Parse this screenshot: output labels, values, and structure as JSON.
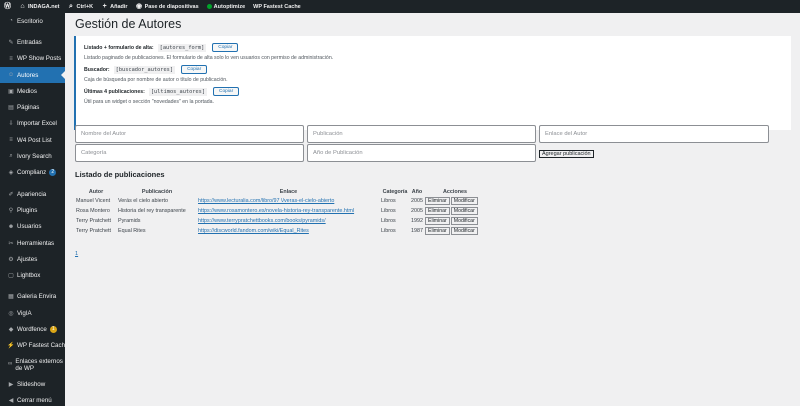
{
  "adminbar": {
    "site": "INDAGA.net",
    "ctrlk": "Ctrl+K",
    "add": "Añadir",
    "slides": "Pase de diapositivas",
    "autoptimize": "Autoptimize",
    "fastest_cache": "WP Fastest Cache"
  },
  "sidebar": {
    "items": [
      {
        "label": "Escritorio",
        "icon": "dashboard-icon"
      },
      {
        "label": "Entradas",
        "icon": "pin-icon"
      },
      {
        "label": "WP Show Posts",
        "icon": "list-icon"
      },
      {
        "label": "Autores",
        "icon": "users-icon"
      },
      {
        "label": "Medios",
        "icon": "media-icon"
      },
      {
        "label": "Páginas",
        "icon": "page-icon"
      },
      {
        "label": "Importar Excel",
        "icon": "import-icon"
      },
      {
        "label": "W4 Post List",
        "icon": "list-icon"
      },
      {
        "label": "Ivory Search",
        "icon": "search-icon"
      },
      {
        "label": "Complianz",
        "icon": "shield-icon",
        "badge": "2"
      },
      {
        "label": "Apariencia",
        "icon": "brush-icon"
      },
      {
        "label": "Plugins",
        "icon": "plugin-icon"
      },
      {
        "label": "Usuarios",
        "icon": "user-icon"
      },
      {
        "label": "Herramientas",
        "icon": "wrench-icon"
      },
      {
        "label": "Ajustes",
        "icon": "settings-icon"
      },
      {
        "label": "Lightbox",
        "icon": "lightbox-icon"
      },
      {
        "label": "Galeria Envira",
        "icon": "gallery-icon"
      },
      {
        "label": "VigIA",
        "icon": "eye-icon"
      },
      {
        "label": "Wordfence",
        "icon": "wordfence-icon",
        "badge": "1"
      },
      {
        "label": "WP Fastest Cache",
        "icon": "cache-icon"
      },
      {
        "label": "Enlaces externos de WP",
        "icon": "link-icon"
      },
      {
        "label": "Slideshow",
        "icon": "slideshow-icon"
      },
      {
        "label": "Cerrar menú",
        "icon": "collapse-icon"
      }
    ],
    "badge_colors": {
      "complianz": "#2271b1",
      "wordfence": "#dba617"
    }
  },
  "page": {
    "title": "Gestión de Autores"
  },
  "shortcodes": [
    {
      "title": "Listado + formulario de alta:",
      "code": "[autores_form]",
      "desc": "Listado paginado de publicaciones. El formulario de alta solo lo ven usuarios con permiso de administración."
    },
    {
      "title": "Buscador:",
      "code": "[buscador_autores]",
      "desc": "Caja de búsqueda por nombre de autor o título de publicación."
    },
    {
      "title": "Últimas 4 publicaciones:",
      "code": "[ultimos_autores]",
      "desc": "Útil para un widget o sección \"novedades\" en la portada."
    }
  ],
  "copy_label": "Copiar",
  "form": {
    "autor_placeholder": "Nombre del Autor",
    "publicacion_placeholder": "Publicación",
    "enlace_placeholder": "Enlace del Autor",
    "categoria_placeholder": "Categoría",
    "anio_placeholder": "Año de Publicación",
    "submit": "Agregar publicación"
  },
  "listing": {
    "title": "Listado de publicaciones",
    "columns": [
      "Autor",
      "Publicación",
      "Enlace",
      "Categoría",
      "Año",
      "Acciones"
    ],
    "delete_label": "Eliminar",
    "edit_label": "Modificar",
    "rows": [
      {
        "autor": "Manuel Vicent",
        "publicacion": "Verás el cielo abierto",
        "enlace": "https://www.lecturalia.com/libro/97 \\/veras-el-cielo-abierto",
        "categoria": "Libros",
        "anio": "2005"
      },
      {
        "autor": "Rosa Montero",
        "publicacion": "Historia del rey transparente",
        "enlace": "https://www.rosamontero.es/novela-historia-rey-transparente.html",
        "categoria": "Libros",
        "anio": "2005"
      },
      {
        "autor": "Terry Pratchett",
        "publicacion": "Pyramids",
        "enlace": "https://www.terrypratchettbooks.com/books/pyramids/",
        "categoria": "Libros",
        "anio": "1992"
      },
      {
        "autor": "Terry Pratchett",
        "publicacion": "Equal Rites",
        "enlace": "https://discworld.fandom.com/wiki/Equal_Rites",
        "categoria": "Libros",
        "anio": "1987"
      }
    ],
    "pager": "1"
  }
}
